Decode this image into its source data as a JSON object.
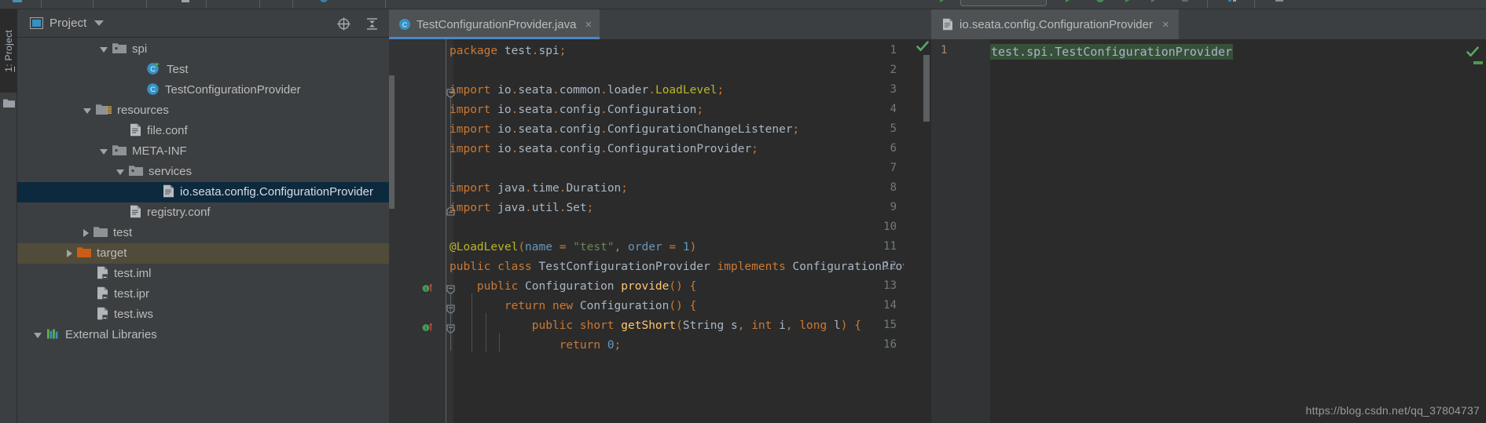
{
  "window": {
    "theme": "Darcula",
    "accent_color": "#4a88c7",
    "bg": "#3c3f41",
    "editor_bg": "#2b2b2b"
  },
  "stripe": {
    "project_tab_prefix": "1",
    "project_tab_label": ": Project",
    "folder_icon": "folder-icon"
  },
  "project_panel": {
    "title": "Project",
    "title_icon": "project-view-icon",
    "dropdown_icon": "chevron-down-icon",
    "actions": [
      {
        "name": "scroll-from-source-button",
        "icon": "target-crosshair-icon"
      },
      {
        "name": "collapse-all-button",
        "icon": "collapse-all-icon"
      }
    ],
    "tree": [
      {
        "label": "spi",
        "icon": "package-folder-icon",
        "indent": 5,
        "arrow": "down",
        "state": "normal"
      },
      {
        "label": "Test",
        "icon": "java-class-runnable-icon",
        "indent": 7,
        "arrow": "none",
        "state": "normal"
      },
      {
        "label": "TestConfigurationProvider",
        "icon": "java-class-icon",
        "indent": 7,
        "arrow": "none",
        "state": "normal"
      },
      {
        "label": "resources",
        "icon": "resources-folder-icon",
        "indent": 4,
        "arrow": "down",
        "state": "normal"
      },
      {
        "label": "file.conf",
        "icon": "config-file-icon",
        "indent": 6,
        "arrow": "none",
        "state": "normal"
      },
      {
        "label": "META-INF",
        "icon": "package-folder-icon",
        "indent": 5,
        "arrow": "down",
        "state": "normal"
      },
      {
        "label": "services",
        "icon": "package-folder-icon",
        "indent": 6,
        "arrow": "down",
        "state": "normal"
      },
      {
        "label": "io.seata.config.ConfigurationProvider",
        "icon": "config-file-icon",
        "indent": 8,
        "arrow": "none",
        "state": "selected"
      },
      {
        "label": "registry.conf",
        "icon": "config-file-icon",
        "indent": 6,
        "arrow": "none",
        "state": "normal"
      },
      {
        "label": "test",
        "icon": "folder-icon",
        "indent": 4,
        "arrow": "right",
        "state": "normal"
      },
      {
        "label": "target",
        "icon": "excluded-folder-icon",
        "indent": 3,
        "arrow": "right",
        "state": "highlighted"
      },
      {
        "label": "test.iml",
        "icon": "module-file-icon",
        "indent": 4,
        "arrow": "none",
        "state": "normal"
      },
      {
        "label": "test.ipr",
        "icon": "module-file-icon",
        "indent": 4,
        "arrow": "none",
        "state": "normal"
      },
      {
        "label": "test.iws",
        "icon": "module-file-icon",
        "indent": 4,
        "arrow": "none",
        "state": "normal"
      },
      {
        "label": "External Libraries",
        "icon": "libraries-icon",
        "indent": 1,
        "arrow": "down",
        "state": "normal"
      }
    ]
  },
  "editor": {
    "tab": {
      "label": "TestConfigurationProvider.java",
      "icon": "java-class-icon",
      "close_icon": "close-icon",
      "close_glyph": "×",
      "active": true
    },
    "lines": [
      {
        "n": "1",
        "run": false,
        "fold": "none"
      },
      {
        "n": "2",
        "run": false,
        "fold": "none"
      },
      {
        "n": "3",
        "run": false,
        "fold": "top"
      },
      {
        "n": "4",
        "run": false,
        "fold": "none"
      },
      {
        "n": "5",
        "run": false,
        "fold": "none"
      },
      {
        "n": "6",
        "run": false,
        "fold": "none"
      },
      {
        "n": "7",
        "run": false,
        "fold": "none"
      },
      {
        "n": "8",
        "run": false,
        "fold": "none"
      },
      {
        "n": "9",
        "run": false,
        "fold": "bottom"
      },
      {
        "n": "10",
        "run": false,
        "fold": "none"
      },
      {
        "n": "11",
        "run": false,
        "fold": "none"
      },
      {
        "n": "12",
        "run": false,
        "fold": "none"
      },
      {
        "n": "13",
        "run": true,
        "fold": "top"
      },
      {
        "n": "14",
        "run": false,
        "fold": "top"
      },
      {
        "n": "15",
        "run": true,
        "fold": "top"
      },
      {
        "n": "16",
        "run": false,
        "fold": "none"
      }
    ],
    "code": [
      "package test.spi;",
      "",
      "import io.seata.common.loader.LoadLevel;",
      "import io.seata.config.Configuration;",
      "import io.seata.config.ConfigurationChangeListener;",
      "import io.seata.config.ConfigurationProvider;",
      "",
      "import java.time.Duration;",
      "import java.util.Set;",
      "",
      "@LoadLevel(name = \"test\", order = 1)",
      "public class TestConfigurationProvider implements ConfigurationProvider {",
      "    public Configuration provide() {",
      "        return new Configuration() {",
      "            public short getShort(String s, int i, long l) {",
      "                return 0;"
    ],
    "inspection_status_icon": "inspection-ok-check-icon"
  },
  "right_editor": {
    "tab": {
      "label": "io.seata.config.ConfigurationProvider",
      "icon": "config-file-icon",
      "close_icon": "close-icon",
      "close_glyph": "×",
      "active": true
    },
    "line_number": "1",
    "content": "test.spi.TestConfigurationProvider",
    "content_highlight_color": "#36503a",
    "inspection_status_icon": "inspection-ok-check-icon"
  },
  "watermark": {
    "text": "https://blog.csdn.net/qq_37804737"
  }
}
